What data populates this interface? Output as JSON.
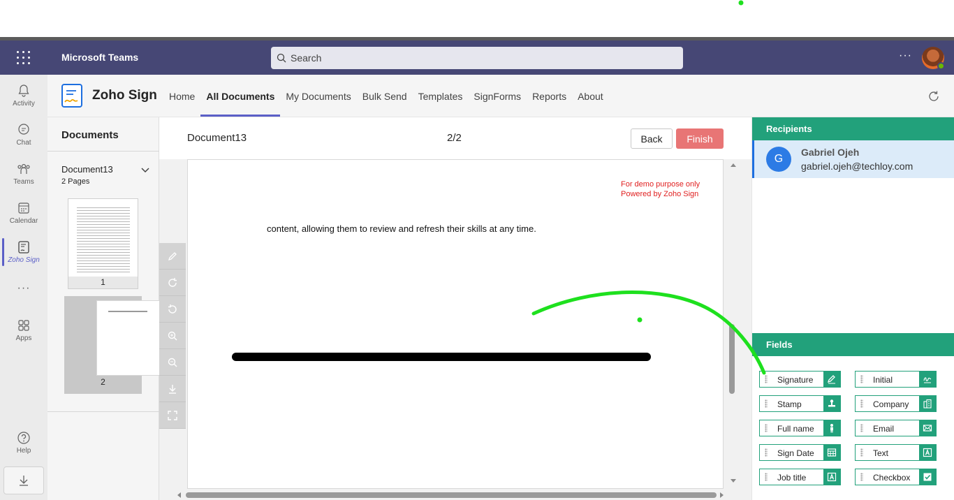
{
  "teams": {
    "app_title": "Microsoft Teams",
    "search_placeholder": "Search",
    "more_label": "···"
  },
  "rail": {
    "items": [
      {
        "label": "Activity",
        "icon": "bell-icon"
      },
      {
        "label": "Chat",
        "icon": "chat-icon"
      },
      {
        "label": "Teams",
        "icon": "teams-icon"
      },
      {
        "label": "Calendar",
        "icon": "calendar-icon"
      },
      {
        "label": "Zoho Sign",
        "icon": "zoho-sign-icon"
      },
      {
        "label": "Apps",
        "icon": "apps-icon"
      },
      {
        "label": "Help",
        "icon": "help-icon"
      }
    ],
    "more_label": "···"
  },
  "app": {
    "name": "Zoho Sign",
    "nav": [
      "Home",
      "All Documents",
      "My Documents",
      "Bulk Send",
      "Templates",
      "SignForms",
      "Reports",
      "About"
    ],
    "active_nav": "All Documents"
  },
  "documents": {
    "title": "Documents",
    "doc_name": "Document13",
    "doc_pages": "2 Pages",
    "thumb1_label": "1",
    "thumb2_label": "2"
  },
  "viewer": {
    "doc_name": "Document13",
    "page_indicator": "2/2",
    "back_label": "Back",
    "finish_label": "Finish",
    "demo_line1": "For demo purpose only",
    "demo_line2": "Powered by Zoho Sign",
    "content_text": "content, allowing them to review and refresh their skills at any time."
  },
  "recipients": {
    "title": "Recipients",
    "avatar_letter": "G",
    "name": "Gabriel Ojeh",
    "email": "gabriel.ojeh@techloy.com"
  },
  "fields": {
    "title": "Fields",
    "left": [
      "Signature",
      "Stamp",
      "Full name",
      "Sign Date",
      "Job title"
    ],
    "right": [
      "Initial",
      "Company",
      "Email",
      "Text",
      "Checkbox"
    ]
  },
  "colors": {
    "teams_bar": "#464775",
    "accent": "#22a17b",
    "finish": "#e87575",
    "active_nav": "#5b5fc7"
  }
}
